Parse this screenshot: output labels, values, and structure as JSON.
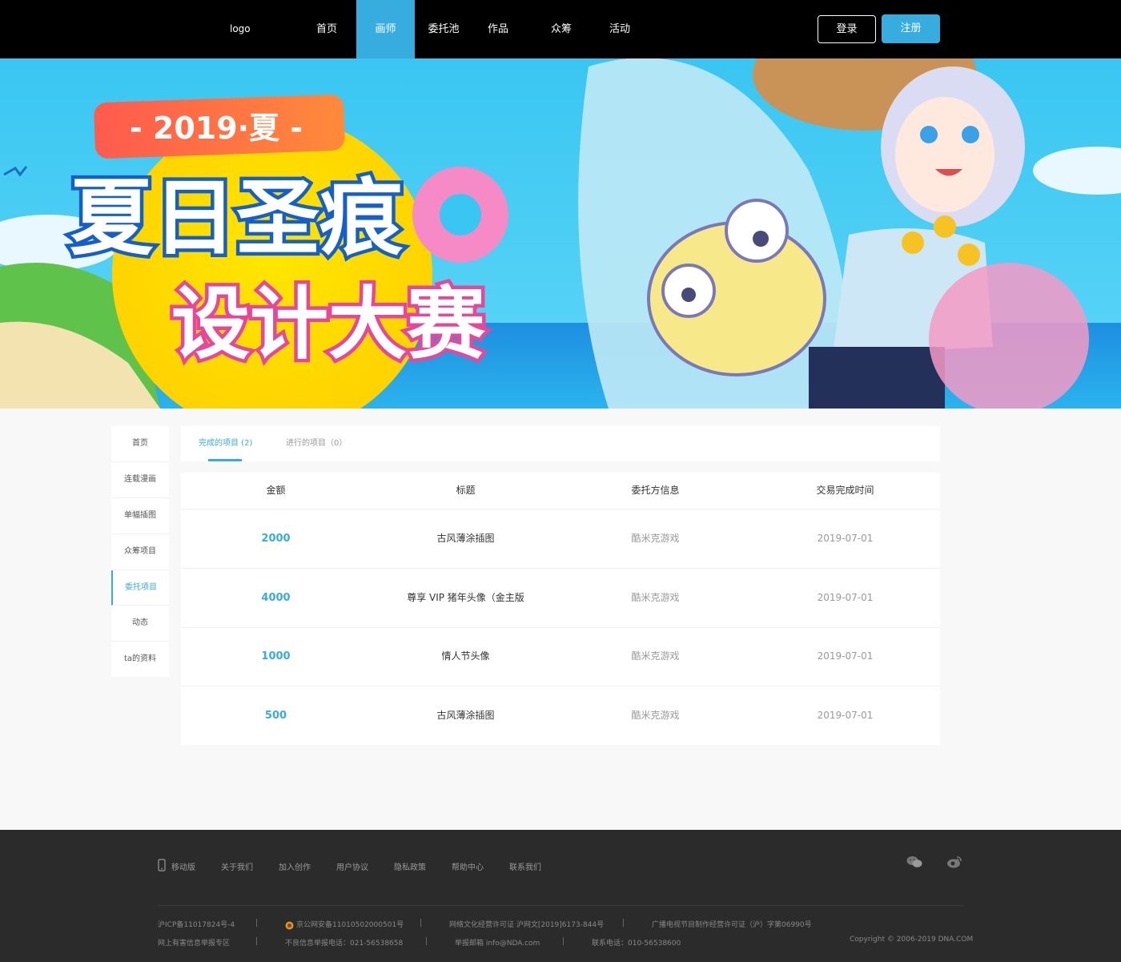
{
  "header": {
    "logo": "logo",
    "nav": [
      "首页",
      "画师",
      "委托池",
      "作品",
      "众筹",
      "活动"
    ],
    "active_nav": "画师",
    "login": "登录",
    "register": "注册"
  },
  "banner": {
    "year_badge": "- 2019·夏 -",
    "title_line1": "夏日圣痕",
    "title_line2": "设计大赛"
  },
  "sidebar": {
    "items": [
      "首页",
      "连载漫画",
      "单幅插图",
      "众筹项目",
      "委托项目",
      "动态",
      "ta的资料"
    ],
    "active": "委托项目"
  },
  "tabs": {
    "completed": "完成的项目 (2)",
    "ongoing": "进行的项目（0）"
  },
  "table": {
    "headers": [
      "金额",
      "标题",
      "委托方信息",
      "交易完成时间"
    ],
    "rows": [
      {
        "amount": "2000",
        "title": "古风薄涂插图",
        "client": "酷米克游戏",
        "date": "2019-07-01"
      },
      {
        "amount": "4000",
        "title": "尊享 VIP 猪年头像（金主版",
        "client": "酷米克游戏",
        "date": "2019-07-01"
      },
      {
        "amount": "1000",
        "title": "情人节头像",
        "client": "酷米克游戏",
        "date": "2019-07-01"
      },
      {
        "amount": "500",
        "title": "古风薄涂插图",
        "client": "酷米克游戏",
        "date": "2019-07-01"
      }
    ]
  },
  "footer": {
    "links": [
      "移动版",
      "关于我们",
      "加入创作",
      "用户协议",
      "隐私政策",
      "帮助中心",
      "联系我们"
    ],
    "icp": "沪ICP备11017824号-4",
    "police": "京公网安备11010502000501号",
    "culture": "网络文化经营许可证 沪网文[2019]6173-844号",
    "radio": "广播电视节目制作经营许可证（沪）字第06990号",
    "report_zone": "网上有害信息举报专区",
    "report_phone": "不良信息举报电话：021-56538658",
    "report_email": "举报邮箱 info@NDA.com",
    "contact_phone": "联系电话：010-56538600",
    "copyright": "Copyright © 2006-2019 DNA.COM",
    "icons": [
      "wechat-icon",
      "weibo-icon",
      "phone-icon",
      "police-badge-icon"
    ]
  },
  "colors": {
    "accent": "#37acdf",
    "header_bg": "#000000",
    "footer_bg": "#2b2b2b",
    "page_bg": "#f8f8f8"
  }
}
